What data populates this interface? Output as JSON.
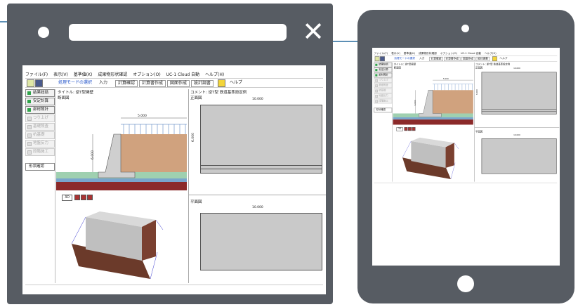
{
  "menu": [
    "ファイル(F)",
    "表示(V)",
    "基準値(K)",
    "成果物形状確認",
    "オプション(O)",
    "UC-1 Cloud 自動",
    "ヘルプ(H)"
  ],
  "toolbar": {
    "mode_select": "処理モードの選択",
    "input": "入力",
    "calc_confirm": "計算確認",
    "calc_doc": "計算書作成",
    "drawing": "図面作成",
    "design_doc": "設計調書",
    "help_short": "ヘルプ"
  },
  "sidebar": {
    "items": [
      {
        "label": "結果総括",
        "active": true
      },
      {
        "label": "安定計算",
        "active": true
      },
      {
        "label": "部材照計",
        "active": true
      },
      {
        "label": "つり上げ",
        "active": false
      },
      {
        "label": "基礎照査",
        "active": false
      },
      {
        "label": "杭基礎",
        "active": false
      },
      {
        "label": "地盤反力",
        "active": false
      },
      {
        "label": "段階施工",
        "active": false
      }
    ],
    "shape_check": "形状確認"
  },
  "panes": {
    "title_label": "タイトル: 逆T型擁壁",
    "comment_label": "コメント: 逆T型 鉄道基準設定例",
    "section_label": "断面図",
    "front_label": "正面図",
    "plan_label": "平面図",
    "dim_5000": "5.000",
    "dim_10000": "10.000",
    "dim_6000": "6.000",
    "btn_3d": "3D"
  },
  "colors": {
    "frame": "#575c63",
    "soil": "#d0a27e",
    "water_green": "#9fd0b0",
    "water_blue": "#79a5cc",
    "ground_red": "#8b2a2a",
    "gray_rect": "#c9c9c9"
  }
}
